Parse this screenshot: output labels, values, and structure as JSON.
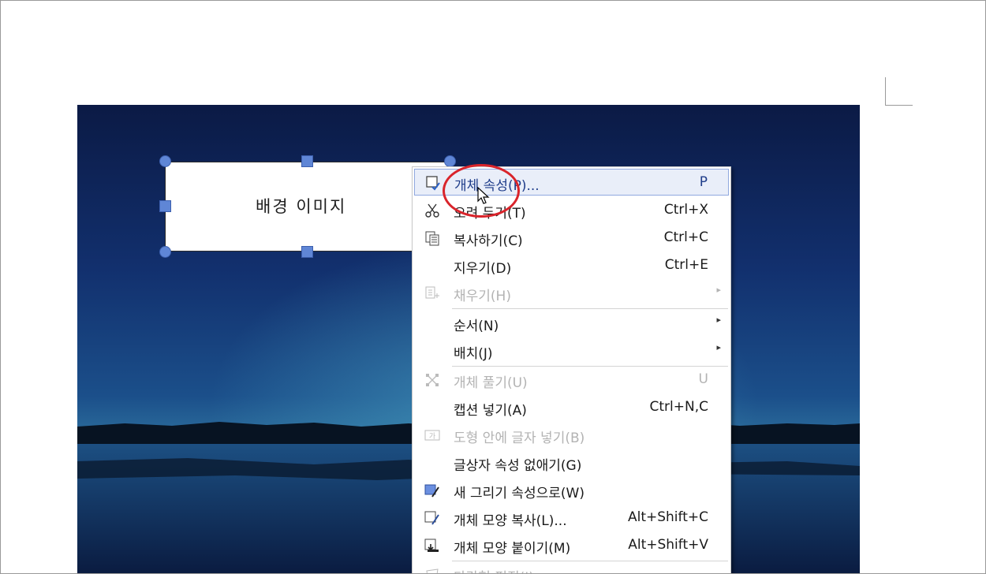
{
  "textbox": {
    "label": "배경 이미지"
  },
  "context_menu": {
    "items": [
      {
        "icon": "object-properties-icon",
        "label": "개체 속성(P)...",
        "shortcut": "P",
        "state": "highlighted"
      },
      {
        "icon": "scissors-icon",
        "label": "오려 두기(T)",
        "shortcut": "Ctrl+X",
        "state": "enabled"
      },
      {
        "icon": "copy-icon",
        "label": "복사하기(C)",
        "shortcut": "Ctrl+C",
        "state": "enabled"
      },
      {
        "icon": "",
        "label": "지우기(D)",
        "shortcut": "Ctrl+E",
        "state": "enabled"
      },
      {
        "icon": "fill-icon",
        "label": "채우기(H)",
        "shortcut": "",
        "state": "disabled",
        "submenu": true
      },
      {
        "icon": "",
        "label": "순서(N)",
        "shortcut": "",
        "state": "enabled",
        "submenu": true
      },
      {
        "icon": "",
        "label": "배치(J)",
        "shortcut": "",
        "state": "enabled",
        "submenu": true
      },
      {
        "icon": "ungroup-icon",
        "label": "개체 풀기(U)",
        "shortcut": "U",
        "state": "disabled"
      },
      {
        "icon": "",
        "label": "캡션 넣기(A)",
        "shortcut": "Ctrl+N,C",
        "state": "enabled"
      },
      {
        "icon": "text-in-shape-icon",
        "label": "도형 안에 글자 넣기(B)",
        "shortcut": "",
        "state": "disabled"
      },
      {
        "icon": "",
        "label": "글상자 속성 없애기(G)",
        "shortcut": "",
        "state": "enabled"
      },
      {
        "icon": "new-drawing-style-icon",
        "label": "새 그리기 속성으로(W)",
        "shortcut": "",
        "state": "enabled"
      },
      {
        "icon": "copy-shape-style-icon",
        "label": "개체 모양 복사(L)...",
        "shortcut": "Alt+Shift+C",
        "state": "enabled"
      },
      {
        "icon": "paste-shape-style-icon",
        "label": "개체 모양 붙이기(M)",
        "shortcut": "Alt+Shift+V",
        "state": "enabled"
      },
      {
        "icon": "polygon-edit-icon",
        "label": "다각형 편집(I)",
        "shortcut": "",
        "state": "disabled"
      }
    ],
    "submenu_arrow": "▸"
  },
  "colors": {
    "highlight_bg": "#e9eef9",
    "highlight_border": "#90a9df",
    "annotation_red": "#d9242b",
    "handle_blue": "#5f86d6",
    "disabled_text": "#b3b3b3"
  }
}
